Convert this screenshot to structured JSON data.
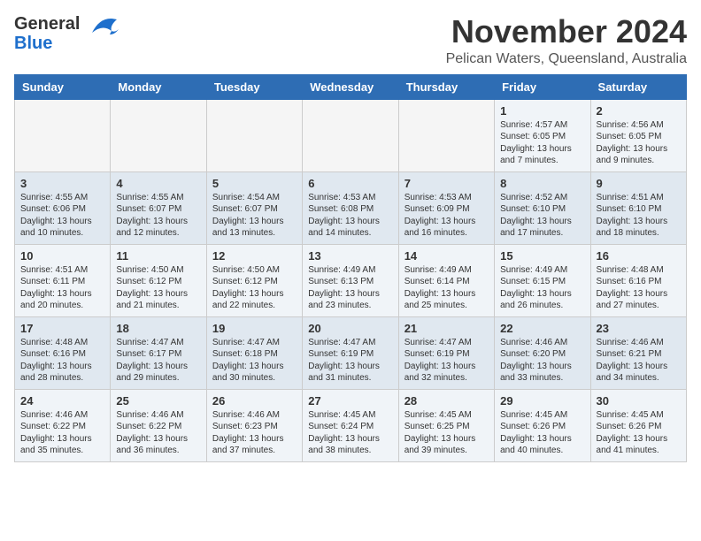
{
  "header": {
    "logo_general": "General",
    "logo_blue": "Blue",
    "month_title": "November 2024",
    "location": "Pelican Waters, Queensland, Australia"
  },
  "weekdays": [
    "Sunday",
    "Monday",
    "Tuesday",
    "Wednesday",
    "Thursday",
    "Friday",
    "Saturday"
  ],
  "weeks": [
    [
      {
        "day": "",
        "info": ""
      },
      {
        "day": "",
        "info": ""
      },
      {
        "day": "",
        "info": ""
      },
      {
        "day": "",
        "info": ""
      },
      {
        "day": "",
        "info": ""
      },
      {
        "day": "1",
        "info": "Sunrise: 4:57 AM\nSunset: 6:05 PM\nDaylight: 13 hours and 7 minutes."
      },
      {
        "day": "2",
        "info": "Sunrise: 4:56 AM\nSunset: 6:05 PM\nDaylight: 13 hours and 9 minutes."
      }
    ],
    [
      {
        "day": "3",
        "info": "Sunrise: 4:55 AM\nSunset: 6:06 PM\nDaylight: 13 hours and 10 minutes."
      },
      {
        "day": "4",
        "info": "Sunrise: 4:55 AM\nSunset: 6:07 PM\nDaylight: 13 hours and 12 minutes."
      },
      {
        "day": "5",
        "info": "Sunrise: 4:54 AM\nSunset: 6:07 PM\nDaylight: 13 hours and 13 minutes."
      },
      {
        "day": "6",
        "info": "Sunrise: 4:53 AM\nSunset: 6:08 PM\nDaylight: 13 hours and 14 minutes."
      },
      {
        "day": "7",
        "info": "Sunrise: 4:53 AM\nSunset: 6:09 PM\nDaylight: 13 hours and 16 minutes."
      },
      {
        "day": "8",
        "info": "Sunrise: 4:52 AM\nSunset: 6:10 PM\nDaylight: 13 hours and 17 minutes."
      },
      {
        "day": "9",
        "info": "Sunrise: 4:51 AM\nSunset: 6:10 PM\nDaylight: 13 hours and 18 minutes."
      }
    ],
    [
      {
        "day": "10",
        "info": "Sunrise: 4:51 AM\nSunset: 6:11 PM\nDaylight: 13 hours and 20 minutes."
      },
      {
        "day": "11",
        "info": "Sunrise: 4:50 AM\nSunset: 6:12 PM\nDaylight: 13 hours and 21 minutes."
      },
      {
        "day": "12",
        "info": "Sunrise: 4:50 AM\nSunset: 6:12 PM\nDaylight: 13 hours and 22 minutes."
      },
      {
        "day": "13",
        "info": "Sunrise: 4:49 AM\nSunset: 6:13 PM\nDaylight: 13 hours and 23 minutes."
      },
      {
        "day": "14",
        "info": "Sunrise: 4:49 AM\nSunset: 6:14 PM\nDaylight: 13 hours and 25 minutes."
      },
      {
        "day": "15",
        "info": "Sunrise: 4:49 AM\nSunset: 6:15 PM\nDaylight: 13 hours and 26 minutes."
      },
      {
        "day": "16",
        "info": "Sunrise: 4:48 AM\nSunset: 6:16 PM\nDaylight: 13 hours and 27 minutes."
      }
    ],
    [
      {
        "day": "17",
        "info": "Sunrise: 4:48 AM\nSunset: 6:16 PM\nDaylight: 13 hours and 28 minutes."
      },
      {
        "day": "18",
        "info": "Sunrise: 4:47 AM\nSunset: 6:17 PM\nDaylight: 13 hours and 29 minutes."
      },
      {
        "day": "19",
        "info": "Sunrise: 4:47 AM\nSunset: 6:18 PM\nDaylight: 13 hours and 30 minutes."
      },
      {
        "day": "20",
        "info": "Sunrise: 4:47 AM\nSunset: 6:19 PM\nDaylight: 13 hours and 31 minutes."
      },
      {
        "day": "21",
        "info": "Sunrise: 4:47 AM\nSunset: 6:19 PM\nDaylight: 13 hours and 32 minutes."
      },
      {
        "day": "22",
        "info": "Sunrise: 4:46 AM\nSunset: 6:20 PM\nDaylight: 13 hours and 33 minutes."
      },
      {
        "day": "23",
        "info": "Sunrise: 4:46 AM\nSunset: 6:21 PM\nDaylight: 13 hours and 34 minutes."
      }
    ],
    [
      {
        "day": "24",
        "info": "Sunrise: 4:46 AM\nSunset: 6:22 PM\nDaylight: 13 hours and 35 minutes."
      },
      {
        "day": "25",
        "info": "Sunrise: 4:46 AM\nSunset: 6:22 PM\nDaylight: 13 hours and 36 minutes."
      },
      {
        "day": "26",
        "info": "Sunrise: 4:46 AM\nSunset: 6:23 PM\nDaylight: 13 hours and 37 minutes."
      },
      {
        "day": "27",
        "info": "Sunrise: 4:45 AM\nSunset: 6:24 PM\nDaylight: 13 hours and 38 minutes."
      },
      {
        "day": "28",
        "info": "Sunrise: 4:45 AM\nSunset: 6:25 PM\nDaylight: 13 hours and 39 minutes."
      },
      {
        "day": "29",
        "info": "Sunrise: 4:45 AM\nSunset: 6:26 PM\nDaylight: 13 hours and 40 minutes."
      },
      {
        "day": "30",
        "info": "Sunrise: 4:45 AM\nSunset: 6:26 PM\nDaylight: 13 hours and 41 minutes."
      }
    ]
  ]
}
